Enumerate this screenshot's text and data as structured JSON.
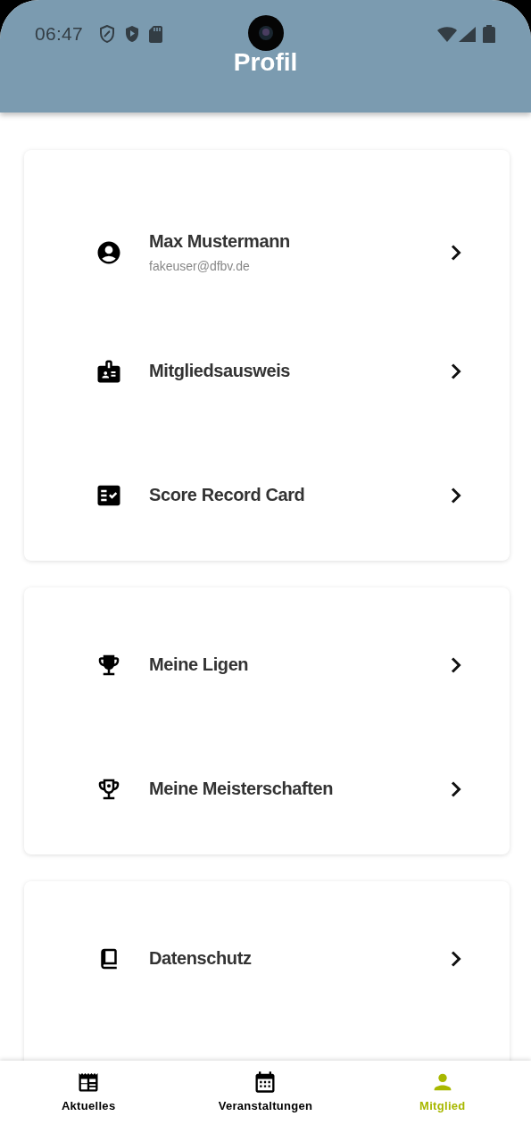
{
  "status_bar": {
    "time": "06:47"
  },
  "header": {
    "title": "Profil"
  },
  "sections": [
    {
      "items": [
        {
          "title": "Max Mustermann",
          "subtitle": "fakeuser@dfbv.de"
        },
        {
          "title": "Mitgliedsausweis"
        },
        {
          "title": "Score Record Card"
        }
      ]
    },
    {
      "items": [
        {
          "title": "Meine Ligen"
        },
        {
          "title": "Meine Meisterschaften"
        }
      ]
    },
    {
      "items": [
        {
          "title": "Datenschutz"
        }
      ]
    }
  ],
  "bottom_nav": [
    {
      "label": "Aktuelles",
      "selected": false
    },
    {
      "label": "Veranstaltungen",
      "selected": false
    },
    {
      "label": "Mitglied",
      "selected": true
    }
  ]
}
